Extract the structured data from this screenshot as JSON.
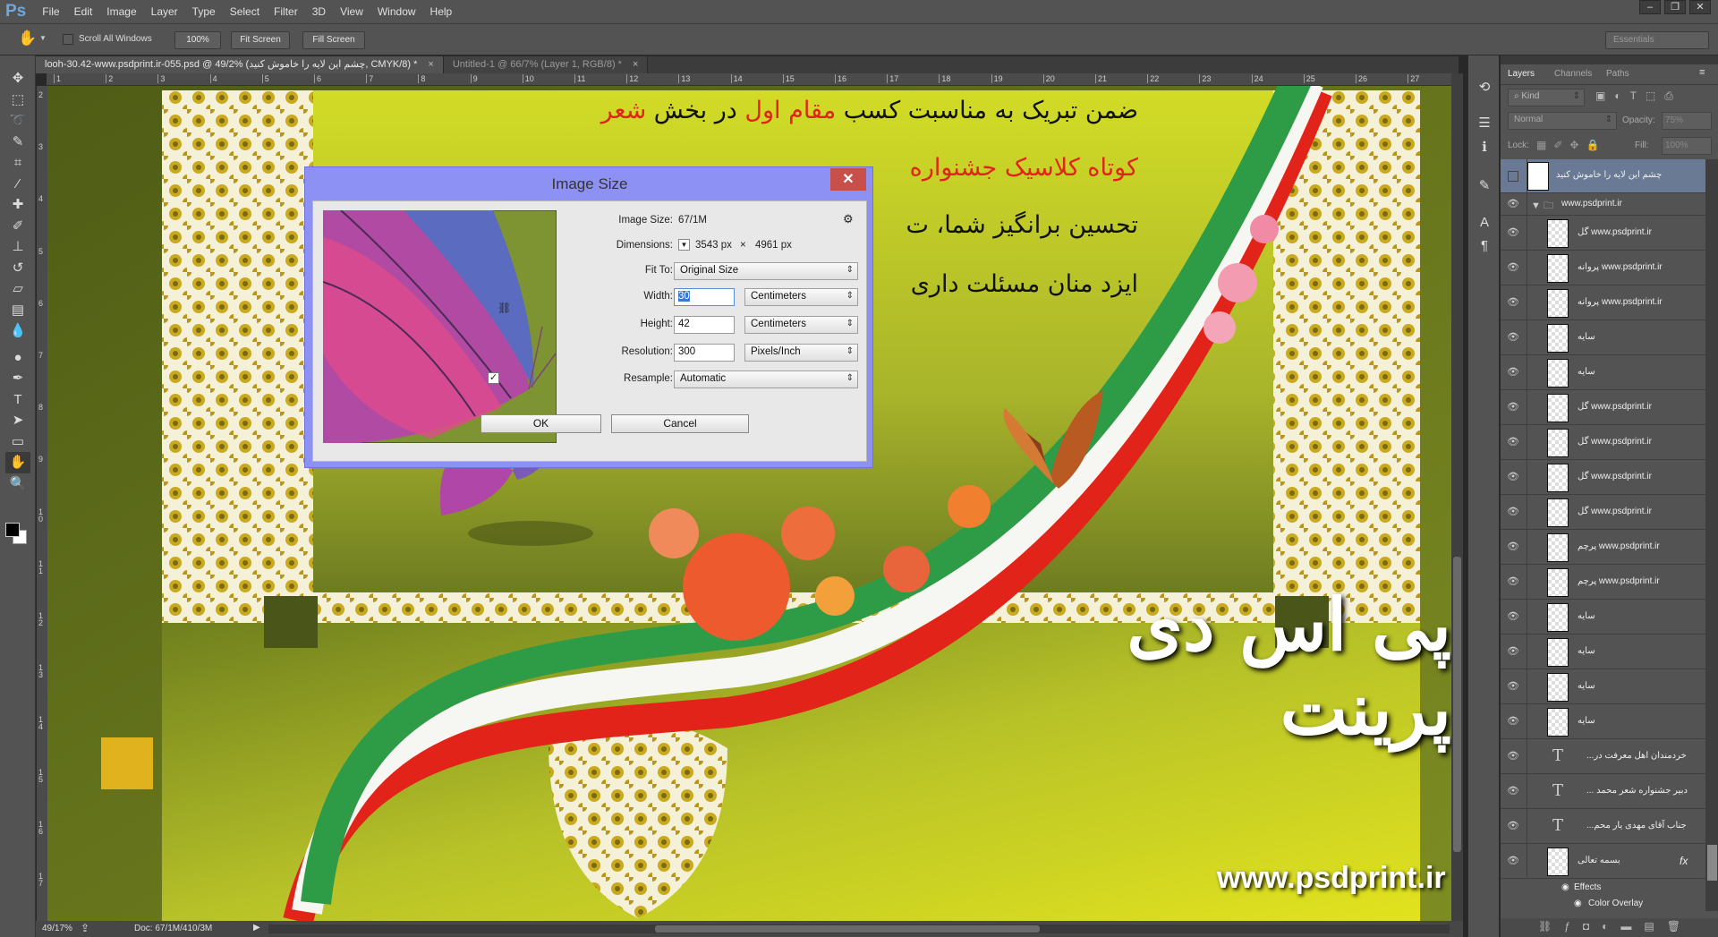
{
  "app": {
    "logo": "Ps",
    "menu": [
      "File",
      "Edit",
      "Image",
      "Layer",
      "Type",
      "Select",
      "Filter",
      "3D",
      "View",
      "Window",
      "Help"
    ],
    "window_buttons": [
      "–",
      "❐",
      "✕"
    ]
  },
  "options": {
    "tool_icon": "hand-icon",
    "scroll_all_windows": "Scroll All Windows",
    "scroll_all_checked": false,
    "zoom_100": "100%",
    "fit_screen": "Fit Screen",
    "fill_screen": "Fill Screen",
    "workspace": "Essentials"
  },
  "tabs": [
    {
      "label": "looh-30.42-www.psdprint.ir-055.psd @ 49/2% (چشم این لایه  را خاموش کنید, CMYK/8) *",
      "active": true
    },
    {
      "label": "Untitled-1 @ 66/7% (Layer 1, RGB/8) *",
      "active": false
    }
  ],
  "rulers": {
    "horizontal": [
      "1",
      "2",
      "3",
      "4",
      "5",
      "6",
      "7",
      "8",
      "9",
      "10",
      "11",
      "12",
      "13",
      "14",
      "15",
      "16",
      "17",
      "18",
      "19",
      "20",
      "21",
      "22",
      "23",
      "24",
      "25",
      "26",
      "27"
    ],
    "vertical": [
      "2",
      "3",
      "4",
      "5",
      "6",
      "7",
      "8",
      "9",
      "10",
      "11",
      "12",
      "13",
      "14",
      "15",
      "16",
      "17"
    ]
  },
  "tools": [
    {
      "name": "move",
      "glyph": "✥"
    },
    {
      "name": "marquee",
      "glyph": "⬚"
    },
    {
      "name": "lasso",
      "glyph": "➰"
    },
    {
      "name": "quick-select",
      "glyph": "✎"
    },
    {
      "name": "crop",
      "glyph": "⌗"
    },
    {
      "name": "eyedropper",
      "glyph": "⁄"
    },
    {
      "name": "healing",
      "glyph": "✚"
    },
    {
      "name": "brush",
      "glyph": "✐"
    },
    {
      "name": "stamp",
      "glyph": "⊥"
    },
    {
      "name": "history-brush",
      "glyph": "↺"
    },
    {
      "name": "eraser",
      "glyph": "▱"
    },
    {
      "name": "gradient",
      "glyph": "▤"
    },
    {
      "name": "blur",
      "glyph": "💧"
    },
    {
      "name": "dodge",
      "glyph": "●"
    },
    {
      "name": "pen",
      "glyph": "✒"
    },
    {
      "name": "type",
      "glyph": "T"
    },
    {
      "name": "path-select",
      "glyph": "➤"
    },
    {
      "name": "rectangle",
      "glyph": "▭"
    },
    {
      "name": "hand",
      "glyph": "✋"
    },
    {
      "name": "zoom",
      "glyph": "🔍"
    }
  ],
  "canvas": {
    "line1": {
      "a": "ضمن تبریک به مناسبت کسب ",
      "b": "مقام اول",
      "c": " در بخش ",
      "d": "شعر"
    },
    "line2": "کوتاه کلاسیک جشنواره",
    "line3": "تحسین برانگیز شما، ت",
    "line4": "ایزد منان مسئلت داری",
    "watermark_url": "www.psdprint.ir",
    "watermark_logo": "پی اس دی پرینت",
    "colors": {
      "background": "#5c6b1c",
      "panel": "#c8d62a",
      "flag_green": "#2e9c46",
      "flag_red": "#e2231a"
    }
  },
  "dialog": {
    "title": "Image Size",
    "image_size_label": "Image Size:",
    "image_size": "67/1M",
    "dimensions_label": "Dimensions:",
    "dim_w": "3543 px",
    "dim_x": "×",
    "dim_h": "4961 px",
    "fit_to_label": "Fit To:",
    "fit_to": "Original Size",
    "width_label": "Width:",
    "width": "30",
    "width_unit": "Centimeters",
    "height_label": "Height:",
    "height": "42",
    "height_unit": "Centimeters",
    "resolution_label": "Resolution:",
    "resolution": "300",
    "resolution_unit": "Pixels/Inch",
    "resample_label": "Resample:",
    "resample": "Automatic",
    "resample_checked": true,
    "ok": "OK",
    "cancel": "Cancel"
  },
  "layers_panel": {
    "tabs": [
      "Layers",
      "Channels",
      "Paths"
    ],
    "kind": "Kind",
    "blend_mode": "Normal",
    "opacity_label": "Opacity:",
    "opacity": "75%",
    "lock_label": "Lock:",
    "fill_label": "Fill:",
    "fill": "100%",
    "layers": [
      {
        "name": "چشم این لایه  را خاموش کنید",
        "type": "pixel",
        "visible": false,
        "selected": true
      },
      {
        "name": "www.psdprint.ir",
        "type": "group",
        "visible": true
      },
      {
        "name": "گل www.psdprint.ir",
        "type": "pixel",
        "visible": true
      },
      {
        "name": "پروانه www.psdprint.ir",
        "type": "pixel",
        "visible": true
      },
      {
        "name": "پروانه www.psdprint.ir",
        "type": "pixel",
        "visible": true
      },
      {
        "name": "سایه",
        "type": "pixel",
        "visible": true
      },
      {
        "name": "سایه",
        "type": "pixel",
        "visible": true
      },
      {
        "name": "گل www.psdprint.ir",
        "type": "pixel",
        "visible": true
      },
      {
        "name": "گل www.psdprint.ir",
        "type": "pixel",
        "visible": true
      },
      {
        "name": "گل www.psdprint.ir",
        "type": "pixel",
        "visible": true
      },
      {
        "name": "گل www.psdprint.ir",
        "type": "pixel",
        "visible": true
      },
      {
        "name": "پرچم www.psdprint.ir",
        "type": "pixel",
        "visible": true
      },
      {
        "name": "پرچم www.psdprint.ir",
        "type": "pixel",
        "visible": true
      },
      {
        "name": "سایه",
        "type": "pixel",
        "visible": true
      },
      {
        "name": "سایه",
        "type": "pixel",
        "visible": true
      },
      {
        "name": "سایه",
        "type": "pixel",
        "visible": true
      },
      {
        "name": "سایه",
        "type": "pixel",
        "visible": true
      },
      {
        "name": "...خردمندان اهل معرفت در",
        "type": "text",
        "visible": true
      },
      {
        "name": "... دبیر جشنواره شعر محمد",
        "type": "text",
        "visible": true
      },
      {
        "name": "...جناب آقای مهدی یار محم",
        "type": "text",
        "visible": true
      },
      {
        "name": "بسمه تعالی",
        "type": "pixel",
        "visible": true,
        "fx": "fx"
      }
    ],
    "effects_label": "Effects",
    "effect": "Color Overlay"
  },
  "status": {
    "zoom": "49/17%",
    "doc": "Doc: 67/1M/410/3M"
  }
}
